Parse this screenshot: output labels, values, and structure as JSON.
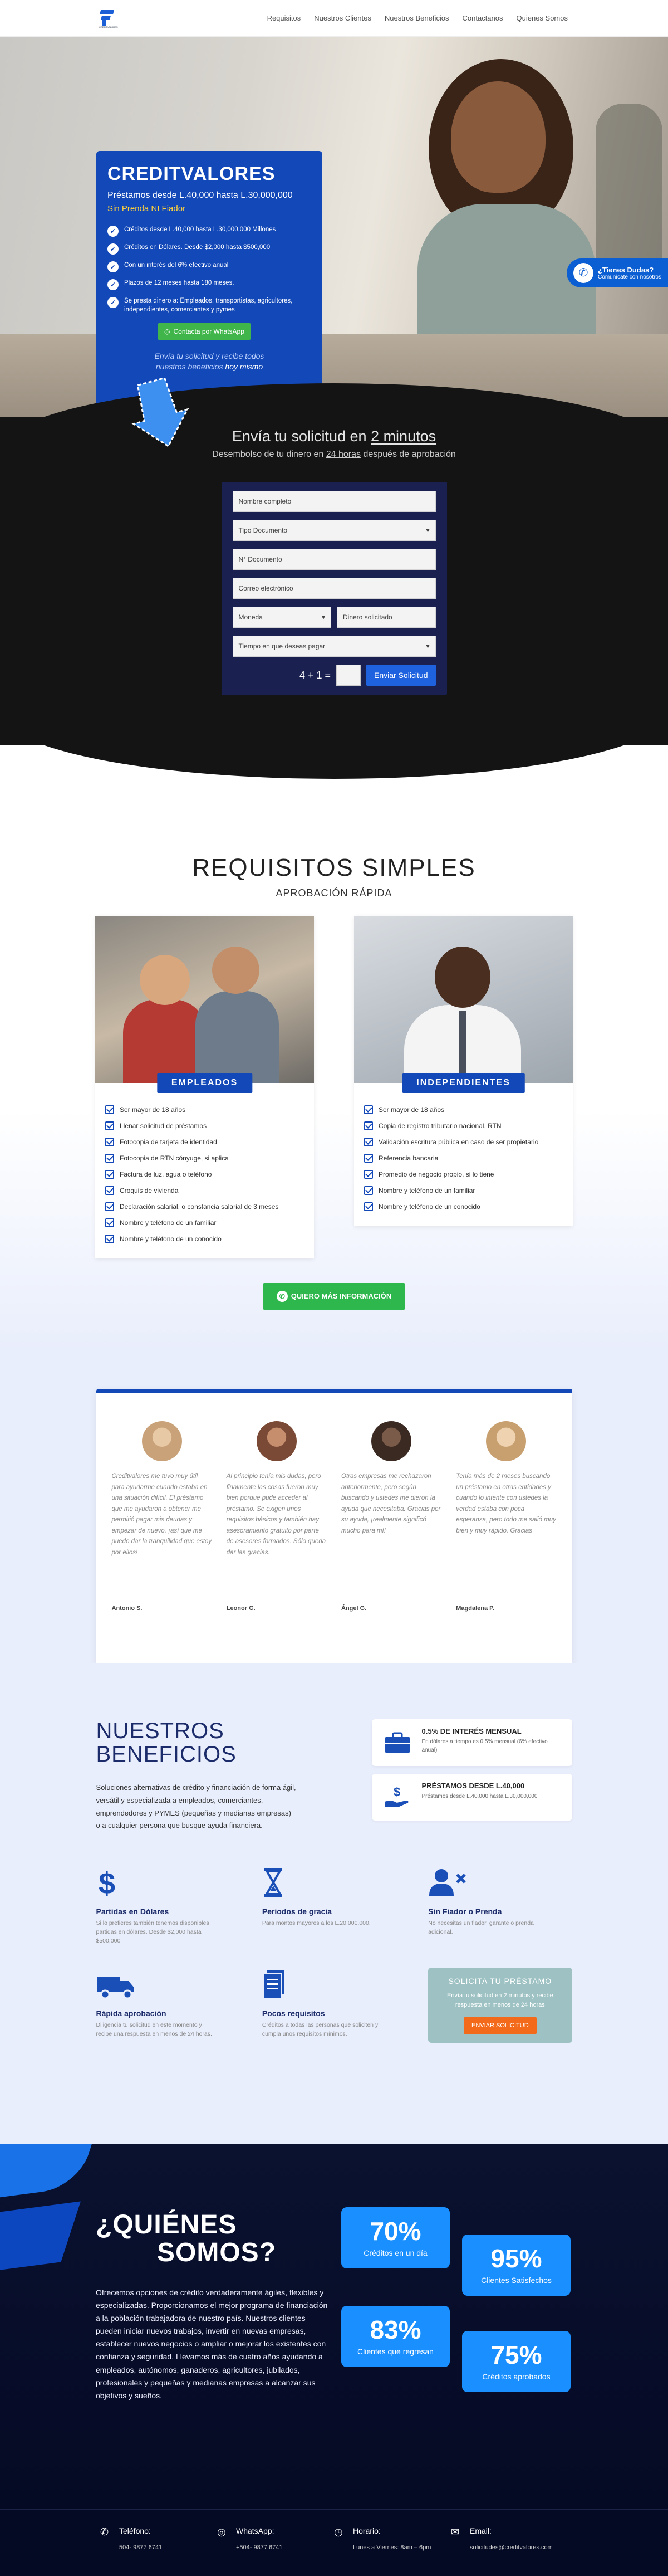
{
  "nav": {
    "logo_text": "CREDITVALORES",
    "links": [
      "Requisitos",
      "Nuestros Clientes",
      "Nuestros Beneficios",
      "Contactanos",
      "Quienes Somos"
    ]
  },
  "hero": {
    "title": "CREDITVALORES",
    "subtitle": "Préstamos desde L.40,000 hasta L.30,000,000",
    "tagline": "Sin Prenda NI Fiador",
    "features": [
      "Créditos desde L.40,000 hasta L.30,000,000 Millones",
      "Créditos en Dólares. Desde $2,000 hasta $500,000",
      "Con un interés del 6% efectivo anual",
      "Plazos de 12 meses hasta 180 meses.",
      "Se presta dinero a: Empleados, transportistas, agricultores, independientes, comerciantes y pymes"
    ],
    "whatsapp_button": "Contacta por WhatsApp",
    "note_line1": "Envía tu solicitud y recibe todos",
    "note_line2_prefix": "nuestros beneficios ",
    "note_line2_emph": "hoy mismo",
    "dudas_title": "¿Tienes Dudas?",
    "dudas_sub": "Comunícate con nosotros"
  },
  "form": {
    "title_prefix": "Envía tu solicitud en ",
    "title_emph": "2 minutos",
    "subtitle_prefix": "Desembolso de tu dinero en ",
    "subtitle_emph": "24 horas",
    "subtitle_suffix": " después de aprobación",
    "name_placeholder": "Nombre completo",
    "doc_type": "Tipo Documento",
    "doc_number_placeholder": "N° Documento",
    "email_placeholder": "Correo electrónico",
    "currency": "Moneda",
    "amount_placeholder": "Dinero solicitado",
    "term": "Tiempo en que deseas pagar",
    "captcha": "4 + 1 =",
    "submit": "Enviar Solicitud"
  },
  "requirements": {
    "title": "REQUISITOS SIMPLES",
    "tag": "APROBACIÓN RÁPIDA",
    "empleados": {
      "label": "EMPLEADOS",
      "items": [
        "Ser mayor de 18 años",
        "Llenar solicitud de préstamos",
        "Fotocopia de tarjeta de identidad",
        "Fotocopia de RTN cónyuge, si aplica",
        "Factura de luz, agua o teléfono",
        "Croquis de vivienda",
        "Declaración salarial, o constancia salarial de 3 meses",
        "Nombre y teléfono de un familiar",
        "Nombre y teléfono de un conocido"
      ]
    },
    "independientes": {
      "label": "INDEPENDIENTES",
      "items": [
        "Ser mayor de 18 años",
        "Copia de registro tributario nacional, RTN",
        "Validación escritura pública en caso de ser propietario",
        "Referencia bancaria",
        "Promedio de negocio propio, si lo tiene",
        "Nombre y teléfono de un familiar",
        "Nombre y teléfono de un conocido"
      ]
    },
    "more_button": "QUIERO MÁS INFORMACIÓN"
  },
  "testimonials": [
    {
      "quote": "Creditvalores me tuvo muy útil para ayudarme cuando estaba en una situación difícil. El préstamo que me ayudaron a obtener me permitió pagar mis deudas y empezar de nuevo, ¡así que me puedo dar la tranquilidad que estoy por ellos!",
      "name": "Antonio S.",
      "color": "#c9a27a"
    },
    {
      "quote": "Al principio tenía mis dudas, pero finalmente las cosas fueron muy bien porque pude acceder al préstamo. Se exigen unos requisitos básicos y también hay asesoramiento gratuito por parte de asesores formados. Sólo queda dar las gracias.",
      "name": "Leonor G.",
      "color": "#7a4a36"
    },
    {
      "quote": "Otras empresas me rechazaron anteriormente, pero según buscando y ustedes me dieron la ayuda que necesitaba. Gracias por su ayuda, ¡realmente significó mucho para mí!",
      "name": "Ángel G.",
      "color": "#3b2a22"
    },
    {
      "quote": "Tenía más de 2 meses buscando un préstamo en otras entidades y cuando lo intente con ustedes la verdad estaba con poca esperanza, pero todo me salió muy bien y muy rápido. Gracias",
      "name": "Magdalena P.",
      "color": "#c8a070"
    }
  ],
  "benefits": {
    "title_line1": "NUESTROS",
    "title_line2": "BENEFICIOS",
    "description": "Soluciones alternativas de crédito y financiación de forma ágil, versátil y especializada a empleados, comerciantes, emprendedores y PYMES (pequeñas y medianas empresas) o a cualquier persona que busque ayuda financiera.",
    "highlight1_title": "0.5% DE INTERÉS MENSUAL",
    "highlight1_sub": "En dólares a tiempo es 0.5% mensual (6% efectivo anual)",
    "highlight2_title": "PRÉSTAMOS DESDE L.40,000",
    "highlight2_sub": "Préstamos desde L.40,000 hasta L.30,000,000",
    "items": [
      {
        "title": "Partidas en Dólares",
        "text": "Si lo prefieres también tenemos disponibles partidas en dólares. Desde $2,000 hasta $500,000",
        "icon": "dollar-icon"
      },
      {
        "title": "Periodos de gracia",
        "text": "Para montos mayores a los L.20,000,000.",
        "icon": "hourglass-icon"
      },
      {
        "title": "Sin Fiador o Prenda",
        "text": "No necesitas un fiador, garante o prenda adicional.",
        "icon": "user-x-icon"
      },
      {
        "title": "Rápida aprobación",
        "text": "Diligencia tu solicitud en este momento y recibe una respuesta en menos de 24 horas.",
        "icon": "truck-icon"
      },
      {
        "title": "Pocos requisitos",
        "text": "Créditos a todas las personas que soliciten y cumpla unos requisitos mínimos.",
        "icon": "document-icon"
      }
    ],
    "cta_title": "SOLICITA TU PRÉSTAMO",
    "cta_text": "Envía tu solicitud en 2 minutos y recibe respuesta en menos de 24 horas",
    "cta_button": "ENVIAR SOLICITUD"
  },
  "about": {
    "title_line1": "¿QUIÉNES",
    "title_line2": "SOMOS?",
    "text": "Ofrecemos opciones de crédito verdaderamente ágiles, flexibles y especializadas. Proporcionamos el mejor programa de financiación a la población trabajadora de nuestro país. Nuestros clientes pueden iniciar nuevos trabajos, invertir en nuevas empresas, establecer nuevos negocios o ampliar o mejorar los existentes con confianza y seguridad. Llevamos más de cuatro años ayudando a empleados, autónomos, ganaderos, agricultores, jubilados, profesionales y pequeñas y medianas empresas a alcanzar sus objetivos y sueños.",
    "stats": [
      {
        "value": "70%",
        "label": "Créditos en un día"
      },
      {
        "value": "95%",
        "label": "Clientes Satisfechos"
      },
      {
        "value": "83%",
        "label": "Clientes que regresan"
      },
      {
        "value": "75%",
        "label": "Créditos aprobados"
      }
    ]
  },
  "footer": [
    {
      "title": "Teléfono:",
      "value": "504- 9877 6741",
      "icon": "phone-icon",
      "glyph": "✆"
    },
    {
      "title": "WhatsApp:",
      "value": "+504- 9877 6741",
      "icon": "whatsapp-icon",
      "glyph": "◎"
    },
    {
      "title": "Horario:",
      "value": "Lunes a Viernes: 8am – 6pm",
      "icon": "clock-icon",
      "glyph": "◷"
    },
    {
      "title": "Email:",
      "value": "solicitudes@creditvalores.com",
      "icon": "mail-icon",
      "glyph": "✉"
    }
  ]
}
